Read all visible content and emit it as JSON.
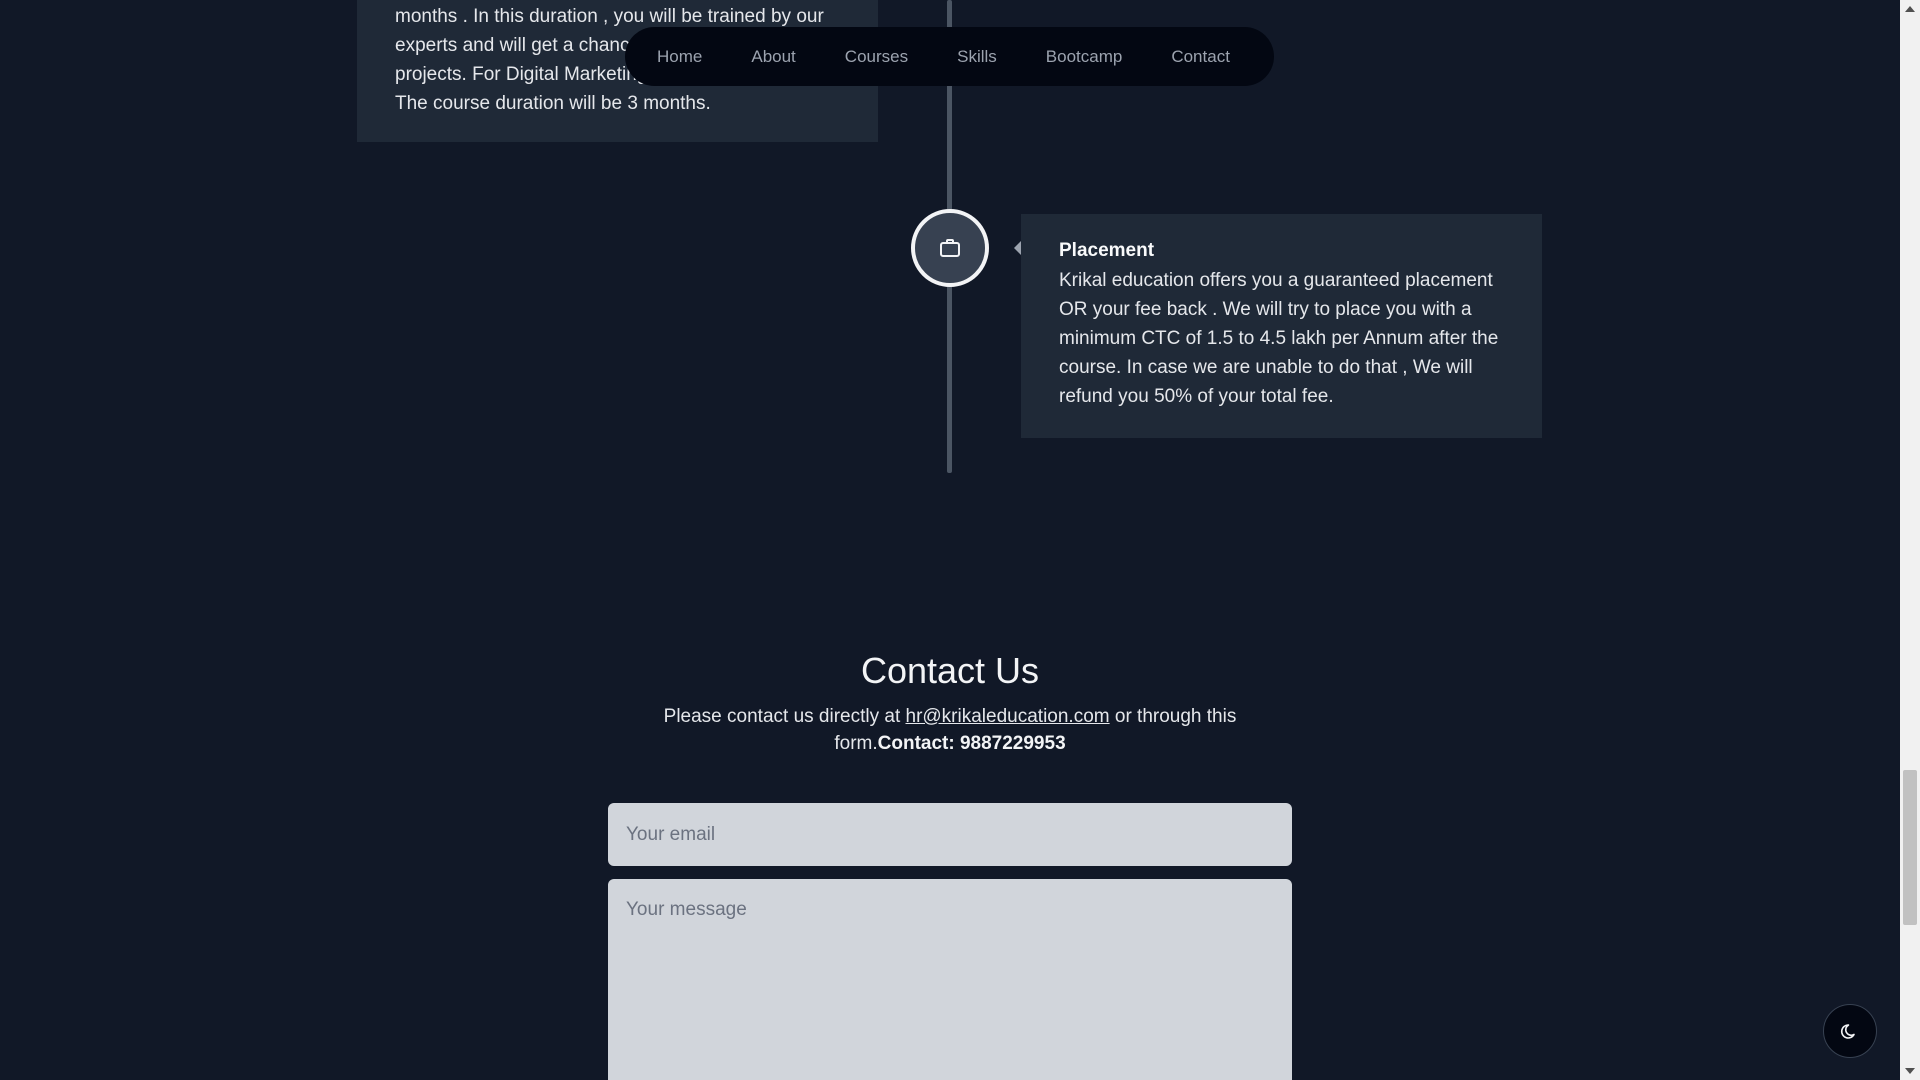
{
  "timeline": {
    "left_card_text": "months . In this duration , you will be trained by our experts and will get a chance to work on live running projects. For Digital Marketing and Graphic Designing The course duration will be 3 months.",
    "placement_title": "Placement",
    "placement_text": "Krikal education offers you a guaranteed placement OR your fee back . We will try to place you with a minimum CTC of 1.5 to 4.5 lakh per Annum after the course. In case we are unable to do that , We will refund you 50% of your total fee."
  },
  "nav": {
    "items": [
      "Home",
      "About",
      "Courses",
      "Skills",
      "Bootcamp",
      "Contact"
    ]
  },
  "contact": {
    "title": "Contact Us",
    "text_before": "Please contact us directly at ",
    "email": "hr@krikaleducation.com",
    "text_after": " or through this form.",
    "phone_label": "Contact: 9887229953",
    "email_placeholder": "Your email",
    "message_placeholder": "Your message"
  },
  "icons": {
    "node_icon": "briefcase-icon",
    "theme_icon": "moon-icon"
  }
}
